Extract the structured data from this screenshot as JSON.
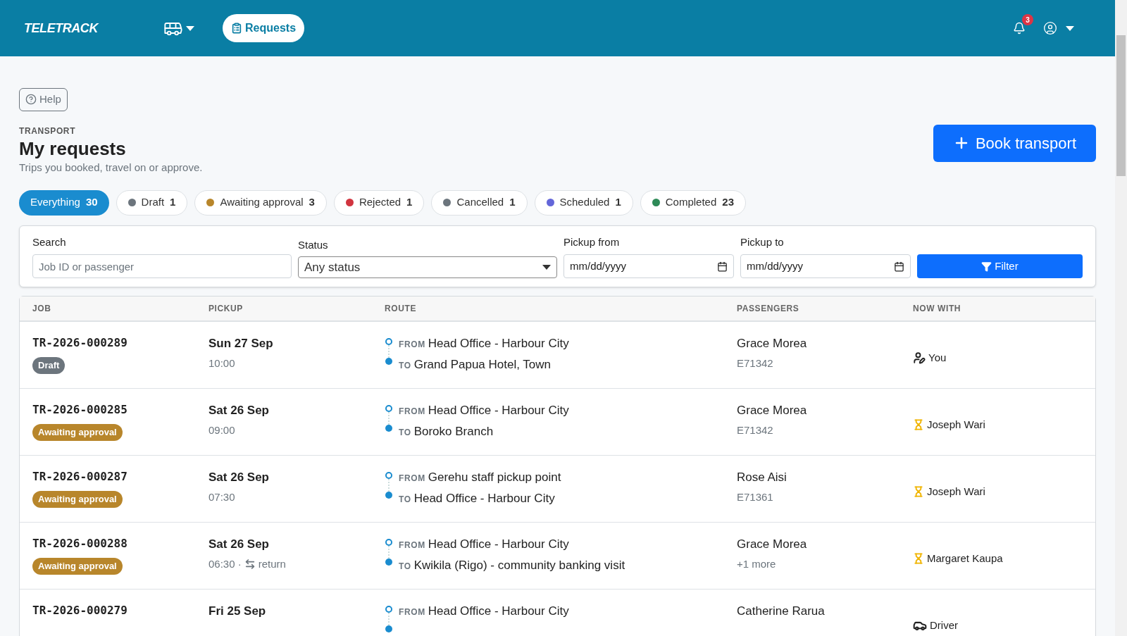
{
  "header": {
    "logo": "TELETRACK",
    "nav": [
      {
        "kind": "vehicles",
        "selected": false
      },
      {
        "kind": "requests",
        "label": "Requests",
        "selected": true
      }
    ],
    "notifications": "3"
  },
  "help": "Help",
  "page": {
    "eyebrow": "TRANSPORT",
    "title": "My requests",
    "subtitle": "Trips you booked, travel on or approve.",
    "action": "Book transport"
  },
  "chips": [
    {
      "label": "Everything",
      "count": "30",
      "selected": true
    },
    {
      "label": "Draft",
      "count": "1",
      "color": "#6c757d",
      "selected": false
    },
    {
      "label": "Awaiting approval",
      "count": "3",
      "color": "#b8862b",
      "selected": false
    },
    {
      "label": "Rejected",
      "count": "1",
      "color": "#d1343f",
      "selected": false
    },
    {
      "label": "Cancelled",
      "count": "1",
      "color": "#6c757d",
      "selected": false
    },
    {
      "label": "Scheduled",
      "count": "1",
      "color": "#6366d9",
      "selected": false
    },
    {
      "label": "Completed",
      "count": "23",
      "color": "#2e8a57",
      "selected": false
    }
  ],
  "filters": {
    "search": {
      "label": "Search",
      "placeholder": "Job ID or passenger"
    },
    "status": {
      "label": "Status",
      "value": "Any status"
    },
    "pickup_from": {
      "label": "Pickup from",
      "value": "mm/dd/yyyy"
    },
    "pickup_to": {
      "label": "Pickup to",
      "value": "mm/dd/yyyy"
    },
    "button": "Filter"
  },
  "table": {
    "columns": [
      "JOB",
      "PICKUP",
      "ROUTE",
      "PASSENGERS",
      "NOW WITH"
    ],
    "rows": [
      {
        "kind": "you",
        "job": "TR-2026-000289",
        "status": "Draft",
        "color": "#6c757d",
        "date": "Sun 27 Sep",
        "time": "10:00",
        "from_label": "FROM",
        "from": "Head Office - Harbour City",
        "to_label": "TO",
        "to": "Grand Papua Hotel, Town",
        "passenger": "Grace Morea",
        "passenger_sub": "E71342",
        "with": "You"
      },
      {
        "kind": "waiting",
        "job": "TR-2026-000285",
        "status": "Awaiting approval",
        "color": "#b8862b",
        "date": "Sat 26 Sep",
        "time": "09:00",
        "from_label": "FROM",
        "from": "Head Office - Harbour City",
        "to_label": "TO",
        "to": "Boroko Branch",
        "passenger": "Grace Morea",
        "passenger_sub": "E71342",
        "with": "Joseph Wari"
      },
      {
        "kind": "waiting",
        "job": "TR-2026-000287",
        "status": "Awaiting approval",
        "color": "#b8862b",
        "date": "Sat 26 Sep",
        "time": "07:30",
        "from_label": "FROM",
        "from": "Gerehu staff pickup point",
        "to_label": "TO",
        "to": "Head Office - Harbour City",
        "passenger": "Rose Aisi",
        "passenger_sub": "E71361",
        "with": "Joseph Wari"
      },
      {
        "kind": "waiting",
        "job": "TR-2026-000288",
        "status": "Awaiting approval",
        "color": "#b8862b",
        "date": "Sat 26 Sep",
        "time": "06:30 ·",
        "return": "return",
        "from_label": "FROM",
        "from": "Head Office - Harbour City",
        "to_label": "TO",
        "to": "Kwikila (Rigo) - community banking visit",
        "passenger": "Grace Morea",
        "passenger_sub": "+1 more",
        "with": "Margaret Kaupa"
      },
      {
        "kind": "driver",
        "job": "TR-2026-000279",
        "date": "Fri 25 Sep",
        "from_label": "FROM",
        "from": "Head Office - Harbour City",
        "passenger": "Catherine Rarua",
        "with": "Driver"
      }
    ]
  }
}
